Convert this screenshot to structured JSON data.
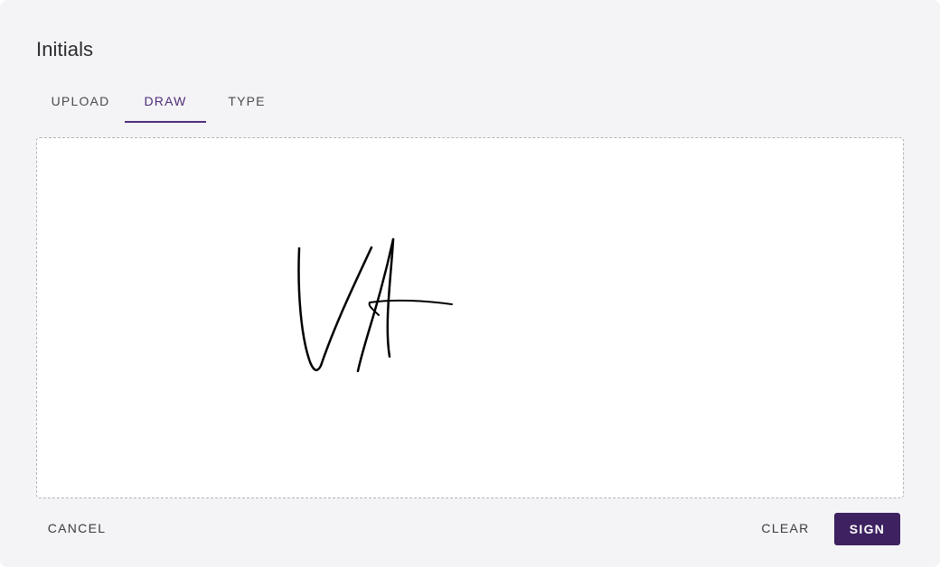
{
  "dialog": {
    "title": "Initials"
  },
  "tabs": [
    {
      "label": "UPLOAD",
      "active": false
    },
    {
      "label": "DRAW",
      "active": true
    },
    {
      "label": "TYPE",
      "active": false
    }
  ],
  "actions": {
    "cancel_label": "CANCEL",
    "clear_label": "CLEAR",
    "sign_label": "SIGN"
  },
  "colors": {
    "accent": "#4f2d7a",
    "primary_button": "#3d2160",
    "stroke": "#000000"
  }
}
